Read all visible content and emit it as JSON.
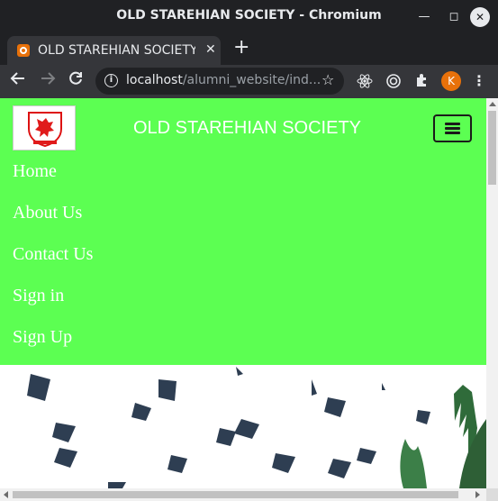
{
  "window": {
    "title": "OLD STAREHIAN SOCIETY - Chromium"
  },
  "tab": {
    "title": "OLD STAREHIAN SOCIETY",
    "close_glyph": "✕",
    "new_tab_glyph": "+"
  },
  "toolbar": {
    "url_host": "localhost",
    "url_path": "/alumni_website/ind...",
    "profile_initial": "K"
  },
  "site": {
    "brand": "OLD STAREHIAN SOCIETY",
    "nav_color": "#5cff52",
    "menu": [
      {
        "label": "Home"
      },
      {
        "label": "About Us"
      },
      {
        "label": "Contact Us"
      },
      {
        "label": "Sign in"
      },
      {
        "label": "Sign Up"
      }
    ]
  },
  "icons": {
    "back": "arrow-left-icon",
    "forward": "arrow-right-icon",
    "reload": "reload-icon",
    "info": "info-icon",
    "star": "star-icon",
    "react_ext": "react-icon",
    "target_ext": "target-icon",
    "extensions": "puzzle-icon",
    "menu": "kebab-menu-icon",
    "hamburger": "hamburger-icon"
  }
}
